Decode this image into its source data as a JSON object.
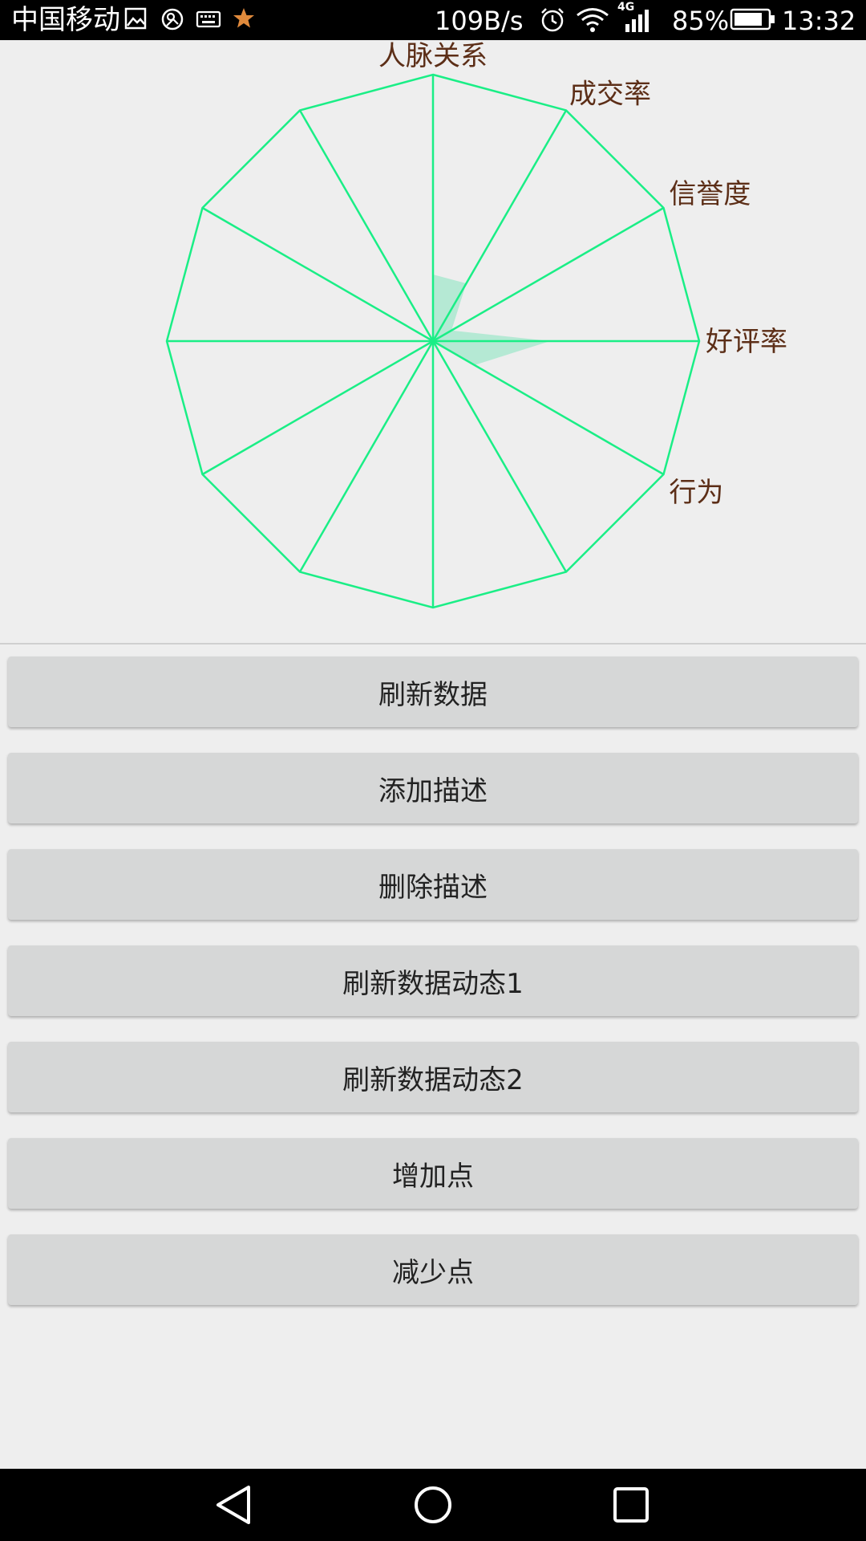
{
  "status_bar": {
    "carrier": "中国移动",
    "net_speed": "109B/s",
    "network_type": "4G",
    "battery": "85%",
    "time": "13:32",
    "icons": [
      "gallery-icon",
      "sync-icon",
      "keyboard-icon",
      "star-icon",
      "alarm-icon",
      "wifi-icon",
      "signal-icon",
      "battery-icon"
    ]
  },
  "chart_data": {
    "type": "radar",
    "axis_count": 12,
    "labels": [
      "人脉关系",
      "成交率",
      "信誉度",
      "好评率",
      "行为",
      "",
      "",
      "",
      "",
      "",
      "",
      ""
    ],
    "values": [
      0.25,
      0.25,
      0.08,
      0.44,
      0.18,
      0,
      0,
      0,
      0,
      0,
      0,
      0
    ],
    "max": 1,
    "colors": {
      "web": "#1aee86",
      "fill": "#aee8d0",
      "label": "#5c2e17"
    }
  },
  "buttons": [
    "刷新数据",
    "添加描述",
    "删除描述",
    "刷新数据动态1",
    "刷新数据动态2",
    "增加点",
    "减少点"
  ],
  "nav_bar": {
    "icons": [
      "back-icon",
      "home-icon",
      "recents-icon"
    ]
  }
}
